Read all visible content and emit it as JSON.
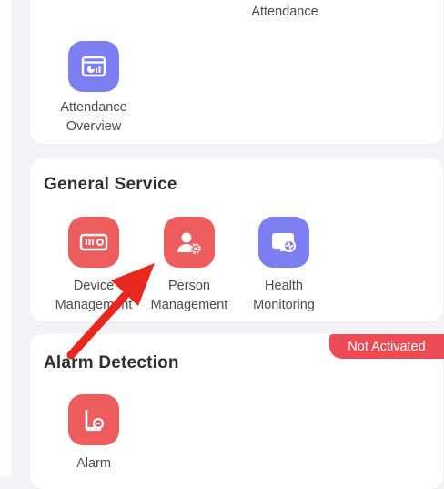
{
  "attendance": {
    "top_label": "Attendance",
    "overview_label": "Attendance\nOverview"
  },
  "general_service": {
    "title": "General Service",
    "items": [
      {
        "label": "Device\nManagement",
        "icon": "device-icon"
      },
      {
        "label": "Person\nManagement",
        "icon": "person-gear-icon"
      },
      {
        "label": "Health\nMonitoring",
        "icon": "health-monitor-icon"
      }
    ]
  },
  "alarm_detection": {
    "title": "Alarm Detection",
    "badge": "Not Activated",
    "items": [
      {
        "label": "Alarm",
        "icon": "alarm-icon"
      }
    ]
  },
  "annotation": {
    "type": "red-arrow",
    "points_to": "Person Management"
  },
  "colors": {
    "blue_icon": "#7b7ff0",
    "red_icon": "#ee5d5d",
    "badge": "#ec4b55",
    "arrow": "#e8281e"
  }
}
